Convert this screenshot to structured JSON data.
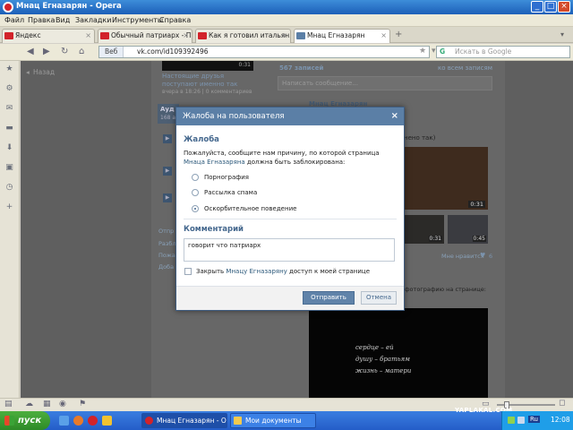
{
  "window": {
    "title": "Мнац Егназарян - Opera",
    "controls": [
      "_",
      "□",
      "×"
    ]
  },
  "menu": [
    "Файл",
    "Правка",
    "Вид",
    "Закладки",
    "Инструменты",
    "Справка"
  ],
  "tabs": [
    {
      "label": "Яндекс",
      "active": false
    },
    {
      "label": "Обычный патриарх - П...",
      "active": false
    },
    {
      "label": "Как я готовил итальян...",
      "active": false
    },
    {
      "label": "Мнац Егназарян",
      "active": true
    }
  ],
  "address": {
    "badge": "Веб",
    "url": "vk.com/id109392496",
    "search_placeholder": "Искать в Google"
  },
  "page_bg": {
    "back_link": "Назад",
    "photo_caption": "Настоящие друзья поступают именно так",
    "photo_meta": "вчера в 18:26 | 0 комментариев",
    "audio_label": "Ауд",
    "audio_count": "168 а",
    "posts_count": "567 записей",
    "all_posts": "ко всем записям",
    "post_input_placeholder": "Написать сообщение...",
    "post_author": "Мнац Егназарян",
    "post_text_tail": "нено так)",
    "video_time_1": "0:31",
    "video_time_2": "0:31",
    "video_time_3": "0:45",
    "likes": "Мне нравится",
    "likes_count": "6",
    "left_links": [
      "Отпр",
      "Разбл",
      "Пожа",
      "Доба"
    ],
    "photo_note": "фотографию на странице:",
    "poem_lines": [
      "сердце – ей",
      "душу – братьям",
      "жизнь – матери"
    ]
  },
  "modal": {
    "title": "Жалоба на пользователя",
    "section_title": "Жалоба",
    "description_prefix": "Пожалуйста, сообщите нам причину, по которой страница",
    "description_link": "Мнаца Егназаряна",
    "description_suffix": "должна быть заблокирована:",
    "options": [
      "Порнография",
      "Рассылка спама",
      "Оскорбительное поведение"
    ],
    "selected_option": "Оскорбительное поведение",
    "comment_title": "Комментарий",
    "comment_value": "говорит что патриарх",
    "close_access_prefix": "Закрыть",
    "close_access_link": "Мнацу Егназаряну",
    "close_access_suffix": "доступ к моей странице",
    "submit_label": "Отправить",
    "cancel_label": "Отмена"
  },
  "taskbar": {
    "start_label": "пуск",
    "tasks": [
      "Мнац Егназарян - О...",
      "Мои документы"
    ],
    "tray_lang": "Ru",
    "clock": "12:08",
    "watermark": "YAPLAKAL.COM"
  }
}
